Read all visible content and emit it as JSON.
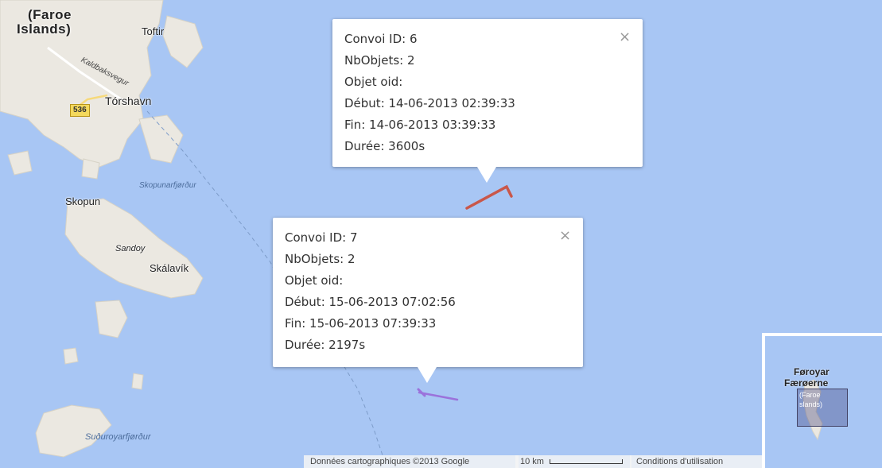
{
  "map": {
    "labels": {
      "faroe_line1": "(Faroe",
      "faroe_line2": "Islands)",
      "toftir": "Toftir",
      "road_name": "Kaldbaksvegur",
      "route_shield": "536",
      "torshavn": "Tórshavn",
      "skopunarfjordur": "Skopunarfjørður",
      "skopun": "Skopun",
      "sandoy": "Sandoy",
      "skalavik": "Skálavík",
      "suduroyarfjordur": "Suðuroyarfjørður"
    },
    "colors": {
      "water": "#a8c6f4",
      "land": "#ebe8e1",
      "convoy6_track": "#c9574a",
      "convoy7_track": "#9b72db"
    }
  },
  "popups": [
    {
      "close_icon": "×",
      "lines": [
        "Convoi ID: 6",
        "NbObjets: 2",
        "Objet oid:",
        "Début: 14-06-2013 02:39:33",
        "Fin: 14-06-2013 03:39:33",
        "Durée: 3600s"
      ]
    },
    {
      "close_icon": "×",
      "lines": [
        "Convoi ID: 7",
        "NbObjets: 2",
        "Objet oid:",
        "Début: 15-06-2013 07:02:56",
        "Fin: 15-06-2013 07:39:33",
        "Durée: 2197s"
      ]
    }
  ],
  "footer": {
    "attribution": "Données cartographiques ©2013 Google",
    "scale_label": "10 km",
    "terms": "Conditions d'utilisation"
  },
  "overview": {
    "label1": "Føroyar",
    "label2": "Færøerne",
    "label3": "(Faroe",
    "label4": "slands)"
  }
}
